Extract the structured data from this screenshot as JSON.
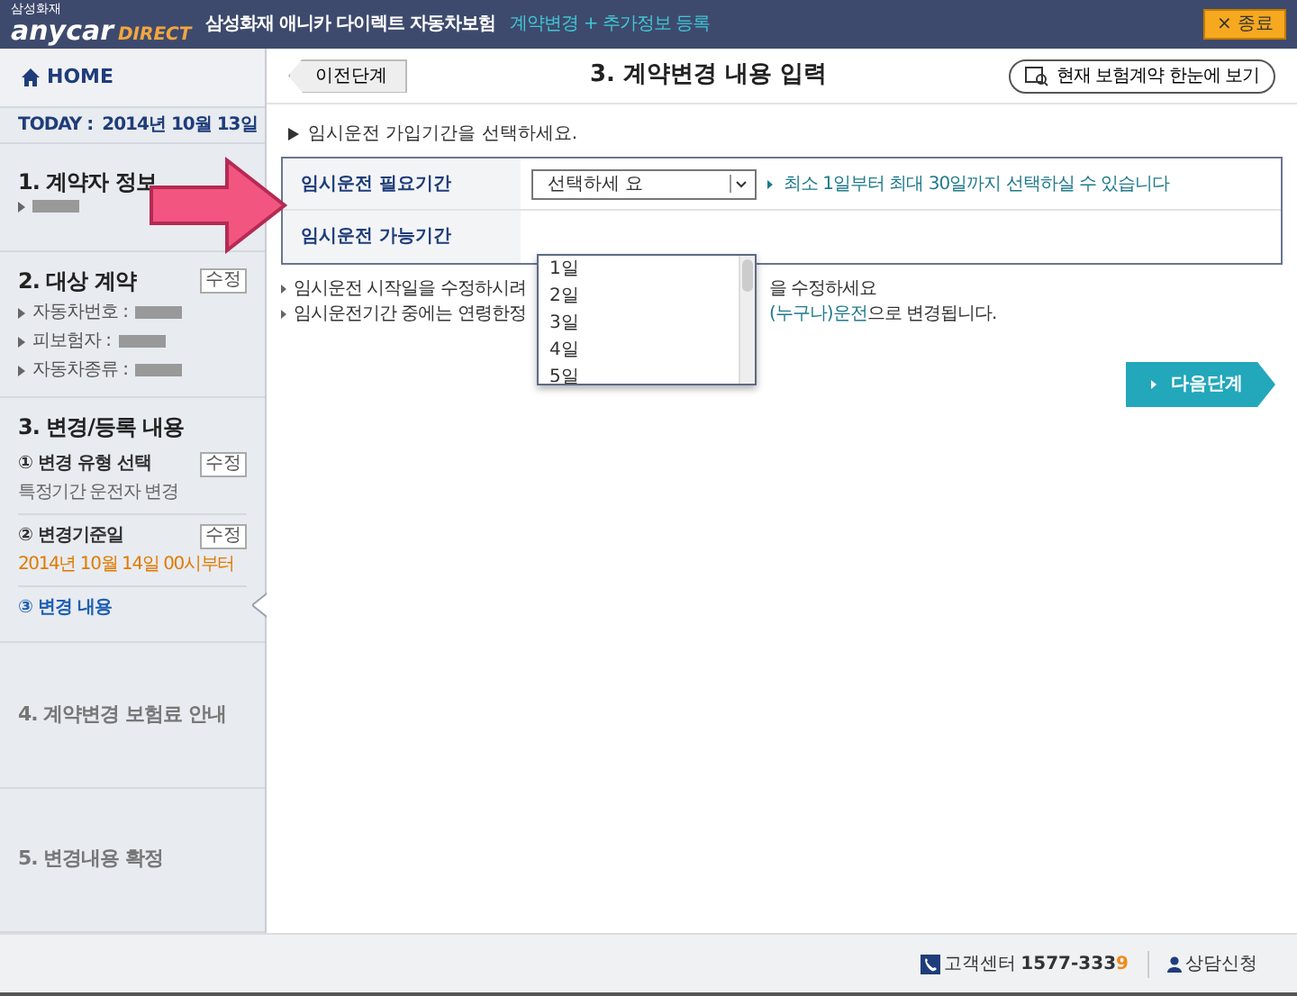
{
  "header": {
    "brand_small": "삼성화재",
    "brand_main": "anycar",
    "brand_direct": "DIRECT",
    "title": "삼성화재 애니카 다이렉트 자동차보험",
    "subtitle": "계약변경 + 추가정보 등록",
    "close_button": "× 종료"
  },
  "sidebar": {
    "home": "HOME",
    "today_label": "TODAY :",
    "today": "2014년 10월 13일",
    "sections": [
      {
        "title": "1. 계약자 정보",
        "kind": "active",
        "fields": [
          {
            "blurred": true
          }
        ]
      },
      {
        "title": "2. 대상 계약",
        "kind": "active",
        "edit": "수정",
        "fields": [
          {
            "label": "자동차번호 :",
            "blurred": true
          },
          {
            "label": "피보험자 :",
            "blurred": true
          },
          {
            "label": "자동차종류 :",
            "blurred": true
          }
        ]
      },
      {
        "title": "3. 변경/등록 내용",
        "kind": "active",
        "steps": [
          {
            "title": "① 변경 유형 선택",
            "edit": "수정",
            "detail": "특정기간 운전자 변경",
            "highlight": false,
            "selected": false
          },
          {
            "title": "② 변경기준일",
            "edit": "수정",
            "detail": "2014년 10월 14일 00시부터",
            "highlight": true,
            "selected": false
          },
          {
            "title": "③ 변경 내용",
            "selected": true
          }
        ]
      },
      {
        "title": "4. 계약변경 보험료 안내",
        "kind": "pending"
      },
      {
        "title": "5. 변경내용 확정",
        "kind": "pending"
      }
    ]
  },
  "main": {
    "prev_button": "이전단계",
    "title": "3. 계약변경 내용 입력",
    "view_button": "현재 보험계약 한눈에 보기",
    "instruction": "임시운전 가입기간을 선택하세요.",
    "form": {
      "rows": [
        {
          "label": "임시운전 필요기간",
          "select": "선택하세 요",
          "hint": "최소 1일부터 최대 30일까지 선택하실 수 있습니다"
        },
        {
          "label": "임시운전 가능기간"
        }
      ],
      "dropdown": {
        "expanded": true,
        "options": [
          "1일",
          "2일",
          "3일",
          "4일",
          "5일"
        ]
      }
    },
    "notes": [
      {
        "left": "임시운전 시작일을 수정하시려",
        "right": "을 수정하세요"
      },
      {
        "left": "임시운전기간 중에는 연령한정",
        "link": "(누구나)운전",
        "rest": "으로 변경됩니다."
      }
    ],
    "next_button": "다음단계"
  },
  "footer": {
    "call_label": "고객센터",
    "phone": "1577-333",
    "phone_last": "9",
    "consult": "상담신청"
  },
  "overlay": {
    "arrow": true
  }
}
